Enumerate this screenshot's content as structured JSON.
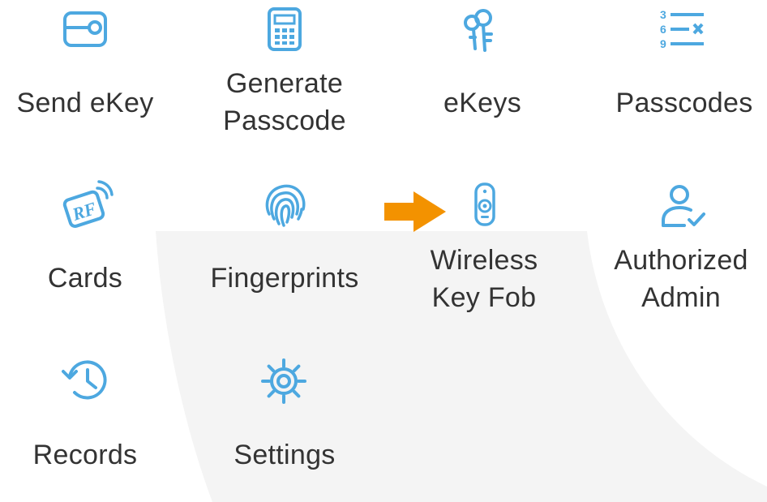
{
  "menu": {
    "items": [
      {
        "id": "send-ekey",
        "label": "Send eKey",
        "icon": "ekey-send-icon"
      },
      {
        "id": "generate-passcode",
        "label": "Generate\nPasscode",
        "icon": "keypad-icon"
      },
      {
        "id": "ekeys",
        "label": "eKeys",
        "icon": "keys-icon"
      },
      {
        "id": "passcodes",
        "label": "Passcodes",
        "icon": "passcode-list-icon"
      },
      {
        "id": "cards",
        "label": "Cards",
        "icon": "rf-card-icon"
      },
      {
        "id": "fingerprints",
        "label": "Fingerprints",
        "icon": "fingerprint-icon"
      },
      {
        "id": "wireless-key-fob",
        "label": "Wireless\nKey Fob",
        "icon": "key-fob-icon"
      },
      {
        "id": "authorized-admin",
        "label": "Authorized\nAdmin",
        "icon": "admin-user-icon"
      },
      {
        "id": "records",
        "label": "Records",
        "icon": "history-clock-icon"
      },
      {
        "id": "settings",
        "label": "Settings",
        "icon": "gear-icon"
      }
    ]
  },
  "highlight": {
    "target": "wireless-key-fob",
    "arrow_icon": "pointer-arrow-icon",
    "arrow_color": "#F39200"
  },
  "colors": {
    "icon": "#4DA8E0",
    "label": "#333333",
    "panel": "#F4F4F4",
    "background": "#FFFFFF"
  }
}
